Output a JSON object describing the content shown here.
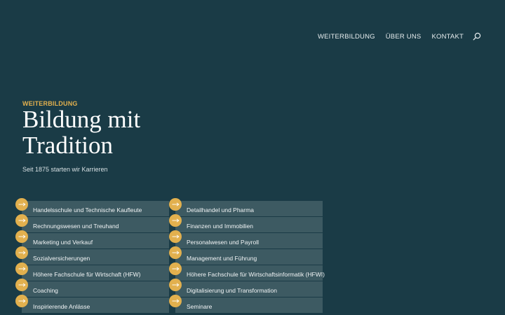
{
  "nav": {
    "items": [
      "WEITERBILDUNG",
      "ÜBER UNS",
      "KONTAKT"
    ]
  },
  "hero": {
    "eyebrow": "WEITERBILDUNG",
    "title_line1": "Bildung mit",
    "title_line2": "Tradition",
    "tagline": "Seit 1875 starten wir Karrieren"
  },
  "links_left": [
    "Handelsschule und Technische Kaufleute",
    "Rechnungswesen und Treuhand",
    "Marketing und Verkauf",
    "Sozialversicherungen",
    "Höhere Fachschule für Wirtschaft (HFW)",
    "Coaching",
    "Inspirierende Anlässe"
  ],
  "links_right": [
    "Detailhandel und Pharma",
    "Finanzen und Immobilien",
    "Personalwesen und Payroll",
    "Management und Führung",
    "Höhere Fachschule für Wirtschaftsinformatik (HFWI)",
    "Digitalisierung und Transformation",
    "Seminare"
  ],
  "colors": {
    "background": "#1a3b46",
    "accent": "#e2b04e",
    "row": "#3d5a62"
  },
  "icons": {
    "search": "search-icon",
    "arrow": "arrow-right-icon"
  }
}
